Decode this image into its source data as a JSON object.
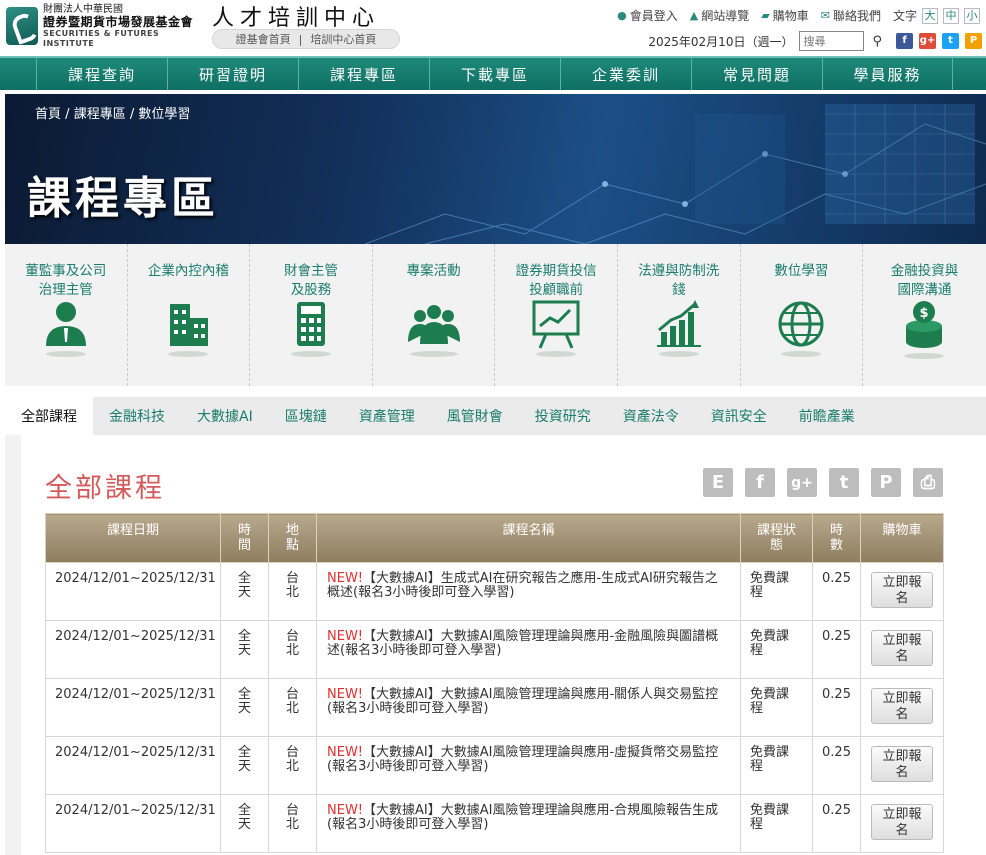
{
  "header": {
    "logo": {
      "line1": "財團法人中華民國",
      "line2": "證券暨期貨市場發展基金會",
      "line3": "SECURITIES & FUTURES INSTITUTE"
    },
    "site_title": "人才培訓中心",
    "subnav": [
      "證基會首頁",
      "|",
      "培訓中心首頁"
    ],
    "top_links": [
      {
        "icon": "person-icon",
        "label": "會員登入"
      },
      {
        "icon": "sitemap-icon",
        "label": "網站導覽"
      },
      {
        "icon": "cart-icon",
        "label": "購物車"
      },
      {
        "icon": "mail-icon",
        "label": "聯絡我們"
      }
    ],
    "font_size_label": "文字",
    "font_sizes": [
      "大",
      "中",
      "小"
    ],
    "date": "2025年02月10日（週一）",
    "search_placeholder": "搜尋",
    "social": [
      {
        "name": "facebook-icon",
        "text": "f",
        "color": "#3b5998"
      },
      {
        "name": "google-plus-icon",
        "text": "g+",
        "color": "#dd4b39"
      },
      {
        "name": "twitter-icon",
        "text": "t",
        "color": "#1da1f2"
      },
      {
        "name": "plurk-icon",
        "text": "P",
        "color": "#f4a000"
      }
    ]
  },
  "main_nav": [
    "課程查詢",
    "研習證明",
    "課程專區",
    "下載專區",
    "企業委訓",
    "常見問題",
    "學員服務"
  ],
  "banner": {
    "breadcrumb": [
      "首頁",
      "/",
      "課程專區",
      "/",
      "數位學習"
    ],
    "title": "課程專區"
  },
  "categories": [
    {
      "line1": "董監事及公司",
      "line2": "治理主管",
      "icon": "executive-icon"
    },
    {
      "line1": "企業內控內稽",
      "line2": "",
      "icon": "building-icon"
    },
    {
      "line1": "財會主管",
      "line2": "及股務",
      "icon": "calculator-icon"
    },
    {
      "line1": "專案活動",
      "line2": "",
      "icon": "group-icon"
    },
    {
      "line1": "證券期貨投信",
      "line2": "投顧職前",
      "icon": "presentation-board-icon"
    },
    {
      "line1": "法遵與防制洗",
      "line2": "錢",
      "icon": "growth-chart-icon"
    },
    {
      "line1": "數位學習",
      "line2": "",
      "icon": "globe-icon"
    },
    {
      "line1": "金融投資與",
      "line2": "國際溝通",
      "icon": "coin-stack-icon"
    }
  ],
  "tabs": [
    "全部課程",
    "金融科技",
    "大數據AI",
    "區塊鏈",
    "資產管理",
    "風管財會",
    "投資研究",
    "資產法令",
    "資訊安全",
    "前瞻產業"
  ],
  "active_tab": "全部課程",
  "section_title": "全部課程",
  "share_buttons": [
    {
      "name": "email-share-icon",
      "text": "E"
    },
    {
      "name": "facebook-share-icon",
      "text": "f"
    },
    {
      "name": "google-plus-share-icon",
      "text": "g+"
    },
    {
      "name": "twitter-share-icon",
      "text": "t"
    },
    {
      "name": "plurk-share-icon",
      "text": "P"
    },
    {
      "name": "print-icon",
      "text": "⎙"
    }
  ],
  "table": {
    "headers": [
      {
        "line1": "課程日期",
        "line2": "",
        "line3": ""
      },
      {
        "line1": "時",
        "line2": "間",
        "line3": ""
      },
      {
        "line1": "地",
        "line2": "點",
        "line3": ""
      },
      {
        "line1": "課程名稱",
        "line2": "",
        "line3": ""
      },
      {
        "line1": "課程狀",
        "line2": "態",
        "line3": ""
      },
      {
        "line1": "時",
        "line2": "數",
        "line3": ""
      },
      {
        "line1": "購物車",
        "line2": "",
        "line3": ""
      }
    ],
    "rows": [
      {
        "date": "2024/12/01~2025/12/31",
        "time1": "全",
        "time2": "天",
        "loc1": "台",
        "loc2": "北",
        "new": "NEW!",
        "name": "【大數據AI】生成式AI在研究報告之應用-生成式AI研究報告之概述(報名3小時後即可登入學習)",
        "status1": "免費課",
        "status2": "程",
        "hours": "0.25",
        "cart1": "立即報",
        "cart2": "名"
      },
      {
        "date": "2024/12/01~2025/12/31",
        "time1": "全",
        "time2": "天",
        "loc1": "台",
        "loc2": "北",
        "new": "NEW!",
        "name": "【大數據AI】大數據AI風險管理理論與應用-金融風險與圖譜概述(報名3小時後即可登入學習)",
        "status1": "免費課",
        "status2": "程",
        "hours": "0.25",
        "cart1": "立即報",
        "cart2": "名"
      },
      {
        "date": "2024/12/01~2025/12/31",
        "time1": "全",
        "time2": "天",
        "loc1": "台",
        "loc2": "北",
        "new": "NEW!",
        "name": "【大數據AI】大數據AI風險管理理論與應用-關係人與交易監控(報名3小時後即可登入學習)",
        "status1": "免費課",
        "status2": "程",
        "hours": "0.25",
        "cart1": "立即報",
        "cart2": "名"
      },
      {
        "date": "2024/12/01~2025/12/31",
        "time1": "全",
        "time2": "天",
        "loc1": "台",
        "loc2": "北",
        "new": "NEW!",
        "name": "【大數據AI】大數據AI風險管理理論與應用-虛擬貨幣交易監控(報名3小時後即可登入學習)",
        "status1": "免費課",
        "status2": "程",
        "hours": "0.25",
        "cart1": "立即報",
        "cart2": "名"
      },
      {
        "date": "2024/12/01~2025/12/31",
        "time1": "全",
        "time2": "天",
        "loc1": "台",
        "loc2": "北",
        "new": "NEW!",
        "name": "【大數據AI】大數據AI風險管理理論與應用-合規風險報告生成(報名3小時後即可登入學習)",
        "status1": "免費課",
        "status2": "程",
        "hours": "0.25",
        "cart1": "立即報",
        "cart2": "名"
      }
    ]
  },
  "colors": {
    "brand_green": "#1a7c6e",
    "nav_green": "#0f6f63",
    "section_title_red": "#d45a5a",
    "table_header_tan": "#9e8e70",
    "course_link_blue": "#2b3aa8",
    "new_red": "#e03030"
  }
}
